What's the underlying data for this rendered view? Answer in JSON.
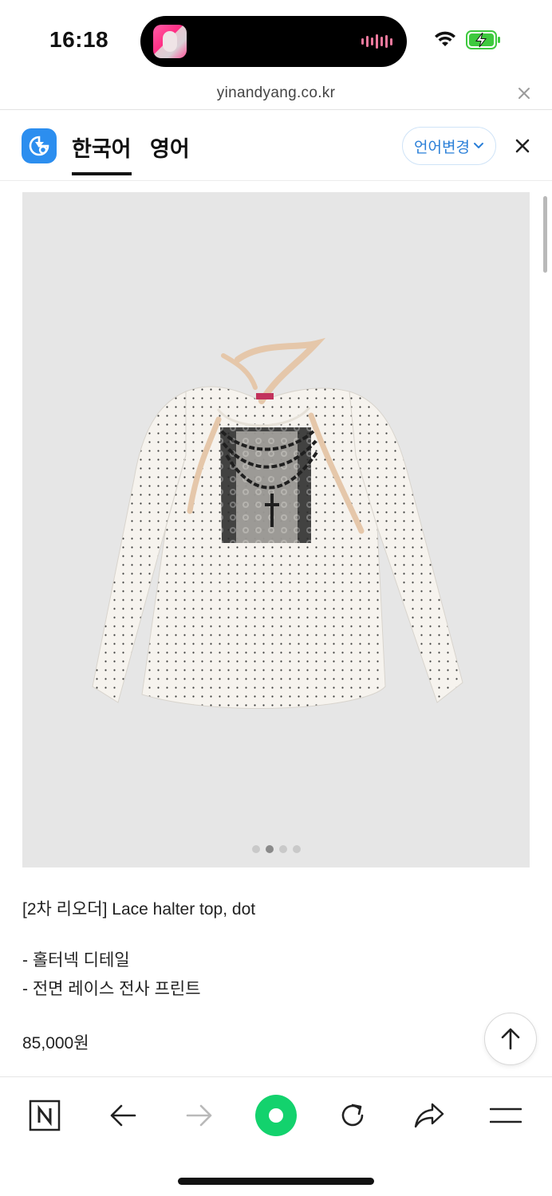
{
  "status_bar": {
    "time": "16:18",
    "icons": [
      "album-art-icon",
      "audio-wave-icon",
      "wifi-icon",
      "battery-charging-icon"
    ]
  },
  "url_bar": {
    "domain": "yinandyang.co.kr"
  },
  "translate_bar": {
    "tabs": [
      {
        "label": "한국어",
        "active": true
      },
      {
        "label": "영어",
        "active": false
      }
    ],
    "change_language_label": "언어변경",
    "accent_color": "#2c8eef"
  },
  "product": {
    "title": "[2차 리오더] Lace halter top, dot",
    "details": [
      "- 홀터넥 디테일",
      "- 전면 레이스 전사 프린트"
    ],
    "price": "85,000원",
    "image_count": 4,
    "active_image": 2
  },
  "toolbar": {
    "items": [
      "naver-home-icon",
      "back-icon",
      "forward-icon",
      "green-dot-icon",
      "refresh-icon",
      "share-icon",
      "menu-icon"
    ]
  }
}
